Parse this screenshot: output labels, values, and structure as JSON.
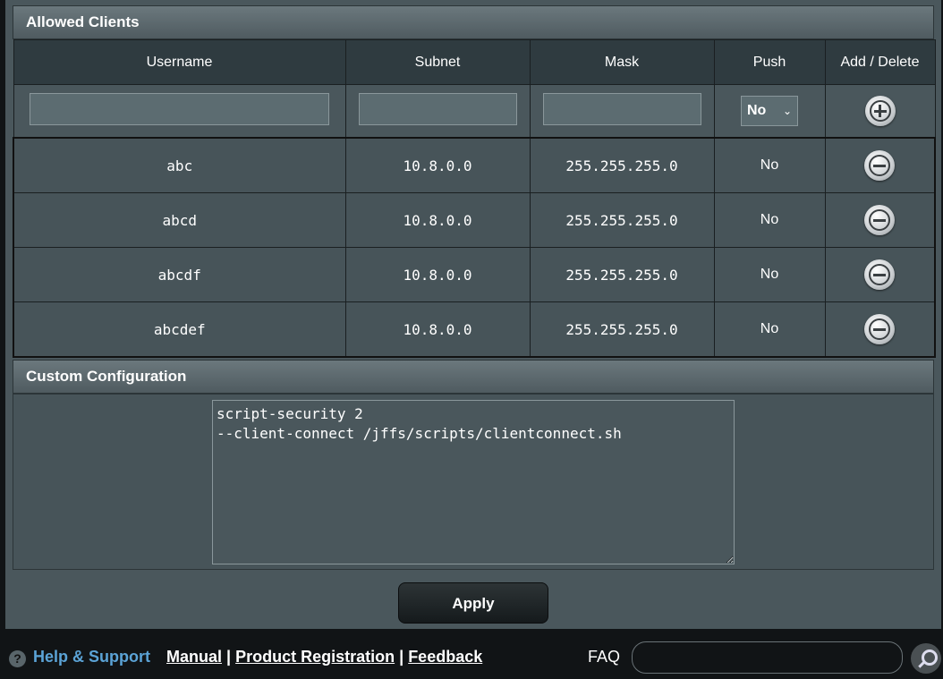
{
  "allowed_clients": {
    "title": "Allowed Clients",
    "columns": [
      "Username",
      "Subnet",
      "Mask",
      "Push",
      "Add / Delete"
    ],
    "new_entry": {
      "username": "",
      "subnet": "",
      "mask": "",
      "push": "No"
    },
    "rows": [
      {
        "username": "abc",
        "subnet": "10.8.0.0",
        "mask": "255.255.255.0",
        "push": "No"
      },
      {
        "username": "abcd",
        "subnet": "10.8.0.0",
        "mask": "255.255.255.0",
        "push": "No"
      },
      {
        "username": "abcdf",
        "subnet": "10.8.0.0",
        "mask": "255.255.255.0",
        "push": "No"
      },
      {
        "username": "abcdef",
        "subnet": "10.8.0.0",
        "mask": "255.255.255.0",
        "push": "No"
      }
    ]
  },
  "custom_configuration": {
    "title": "Custom Configuration",
    "text": "script-security 2\n--client-connect /jffs/scripts/clientconnect.sh"
  },
  "apply_label": "Apply",
  "footer": {
    "help": "Help & Support",
    "manual": "Manual",
    "separator": "|",
    "product_registration": "Product Registration",
    "feedback": "Feedback",
    "faq": "FAQ",
    "faq_value": ""
  },
  "icons": {
    "add": "plus-circle-icon",
    "delete": "minus-circle-icon",
    "help": "question-circle-icon",
    "search": "search-icon"
  }
}
